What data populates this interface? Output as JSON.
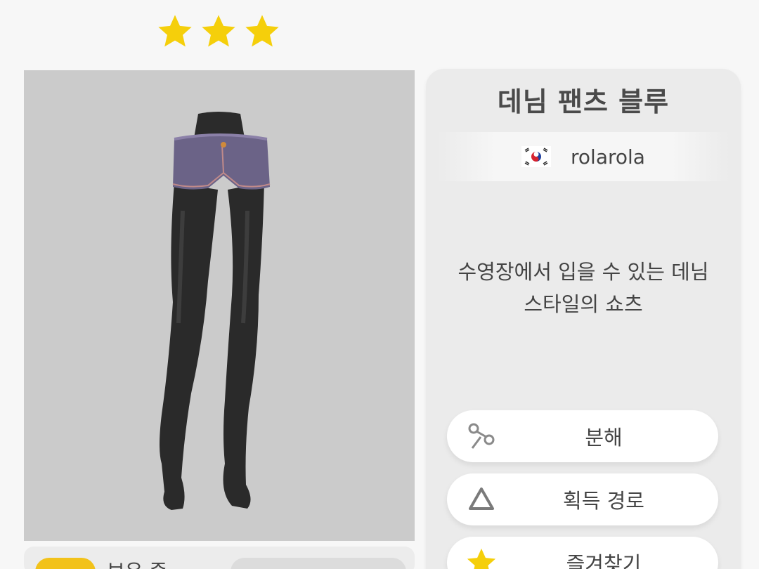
{
  "rating": {
    "stars": 3,
    "star_color": "#f5cf0b"
  },
  "item": {
    "title": "데님 팬츠 블루",
    "creator": {
      "country_flag": "south-korea-flag",
      "name": "rolarola"
    },
    "description_line1": "수영장에서 입을 수 있는 데님",
    "description_line2": "스타일의 쇼츠"
  },
  "actions": {
    "disassemble_label": "분해",
    "acquire_label": "획득 경로",
    "favorite_label": "즐겨찾기"
  },
  "inventory": {
    "owned_label": "보유 중"
  },
  "colors": {
    "accent": "#f5cf0b",
    "preview_bg": "#cbcbcb",
    "panel_bg": "#ebebeb",
    "shorts": "#6b6387",
    "legs": "#2a2a2a"
  }
}
